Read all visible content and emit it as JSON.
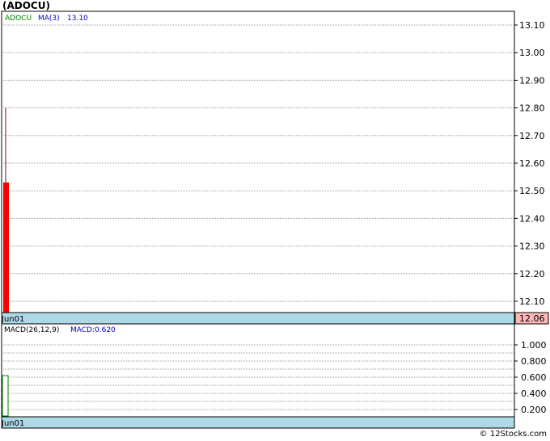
{
  "header": {
    "title": "(ADOCU)"
  },
  "footer": {
    "credit": "© 12Stocks.com"
  },
  "chart_data": [
    {
      "type": "candlestick",
      "legend": {
        "symbol": "ADOCU",
        "ma_label": "MA(3)",
        "ma_value": "13.10"
      },
      "x_axis": {
        "date_label": "Jun01"
      },
      "y_ticks": [
        "13.10",
        "13.00",
        "12.90",
        "12.80",
        "12.70",
        "12.60",
        "12.50",
        "12.40",
        "12.30",
        "12.20",
        "12.10"
      ],
      "ylim": [
        12.06,
        13.1
      ],
      "candles": [
        {
          "date": "Jun01",
          "open": 12.53,
          "high": 12.8,
          "low": 12.06,
          "close": 12.06,
          "color": "#ff0000"
        }
      ],
      "last_price": "12.06",
      "grid": true
    },
    {
      "type": "bar",
      "legend": {
        "name": "MACD(26,12,9)",
        "value_label": "MACD:0.620"
      },
      "x_axis": {
        "date_label": "Jun01"
      },
      "y_ticks": [
        "1.000",
        "0.800",
        "0.600",
        "0.400",
        "0.200"
      ],
      "ylim": [
        0.0,
        1.1
      ],
      "bars": [
        {
          "date": "Jun01",
          "value": 0.62,
          "color": "#008000"
        }
      ],
      "grid": true
    }
  ],
  "colors": {
    "axis_band": "#add8e6",
    "price_badge": "#ffb6b6",
    "up": "#008000",
    "down": "#ff0000",
    "ma_text": "#0000cc",
    "symbol_text": "#008000"
  }
}
